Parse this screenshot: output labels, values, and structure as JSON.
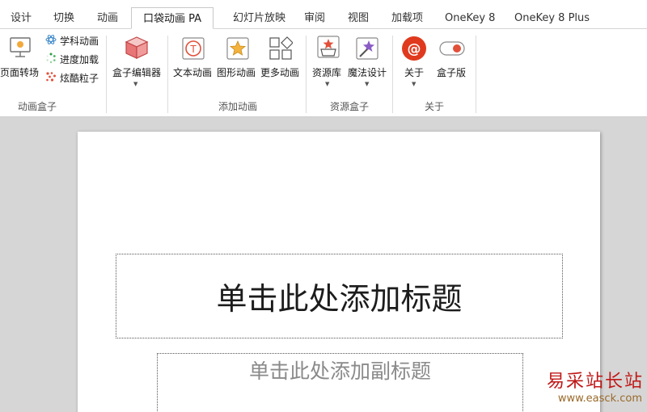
{
  "tabs": [
    {
      "label": "设计"
    },
    {
      "label": "切换"
    },
    {
      "label": "动画"
    },
    {
      "label": "口袋动画 PA",
      "active": true
    },
    {
      "label": "幻灯片放映"
    },
    {
      "label": "审阅"
    },
    {
      "label": "视图"
    },
    {
      "label": "加载项"
    },
    {
      "label": "OneKey 8"
    },
    {
      "label": "OneKey 8 Plus"
    }
  ],
  "ribbon": {
    "groups": {
      "animation_box": "动画盒子",
      "add_animation": "添加动画",
      "resource_box": "资源盒子",
      "about": "关于"
    },
    "buttons": {
      "page_transition": "页面转场",
      "subject_animation": "学科动画",
      "progress_load": "进度加载",
      "cool_particles": "炫酷粒子",
      "box_editor": "盒子编辑器",
      "text_animation": "文本动画",
      "shape_animation": "图形动画",
      "more_animation": "更多动画",
      "resource_library": "资源库",
      "magic_design": "魔法设计",
      "about": "关于",
      "box_version": "盒子版"
    }
  },
  "slide": {
    "title_placeholder": "单击此处添加标题",
    "subtitle_placeholder": "单击此处添加副标题"
  },
  "watermark": {
    "text": "易采站长站",
    "url": "www.easck.com"
  },
  "colors": {
    "accent_red": "#e03a1e",
    "watermark_red": "#c01818"
  }
}
